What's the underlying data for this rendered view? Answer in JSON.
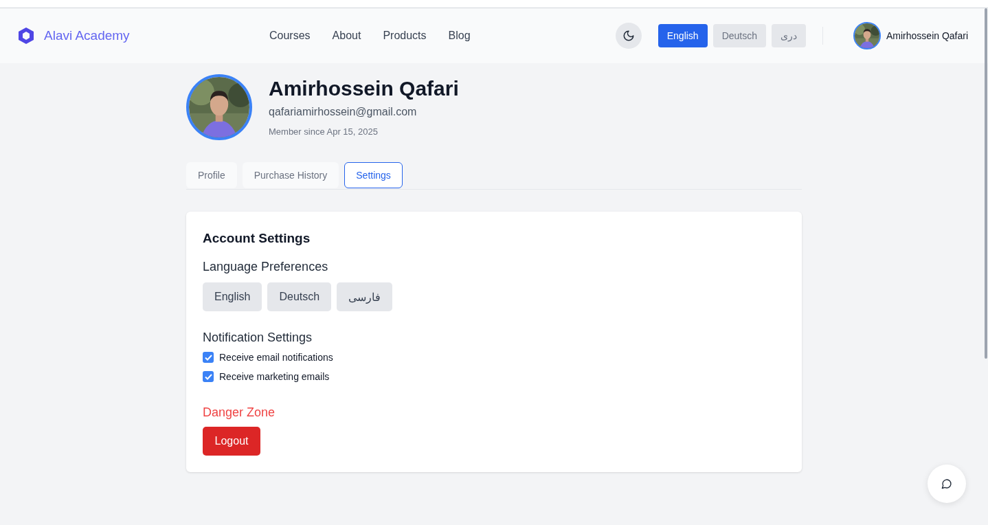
{
  "header": {
    "brand": "Alavi Academy",
    "nav": [
      {
        "label": "Courses"
      },
      {
        "label": "About"
      },
      {
        "label": "Products"
      },
      {
        "label": "Blog"
      }
    ],
    "languages": [
      {
        "label": "English",
        "selected": true
      },
      {
        "label": "Deutsch",
        "selected": false
      },
      {
        "label": "دری",
        "selected": false
      }
    ],
    "user": {
      "name": "Amirhossein Qafari"
    }
  },
  "profile": {
    "name": "Amirhossein Qafari",
    "email": "qafariamirhossein@gmail.com",
    "member_since": "Member since Apr 15, 2025"
  },
  "tabs": [
    {
      "label": "Profile",
      "selected": false
    },
    {
      "label": "Purchase History",
      "selected": false
    },
    {
      "label": "Settings",
      "selected": true
    }
  ],
  "settings": {
    "title": "Account Settings",
    "language_heading": "Language Preferences",
    "languages": [
      {
        "label": "English",
        "selected": false
      },
      {
        "label": "Deutsch",
        "selected": false
      },
      {
        "label": "فارسی",
        "selected": false
      }
    ],
    "notification_heading": "Notification Settings",
    "notifications": [
      {
        "label": "Receive email notifications",
        "checked": true
      },
      {
        "label": "Receive marketing emails",
        "checked": true
      }
    ],
    "danger_heading": "Danger Zone",
    "logout": "Logout"
  }
}
